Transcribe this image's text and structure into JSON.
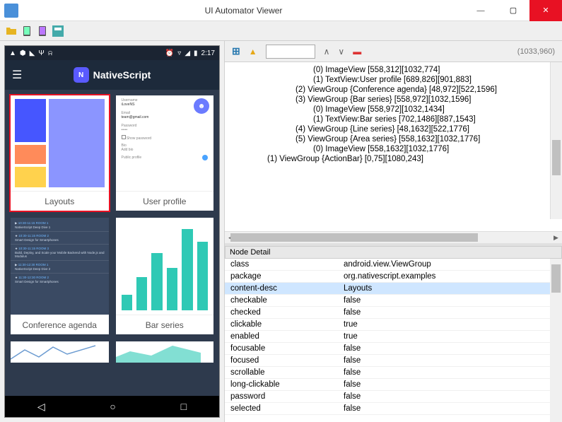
{
  "window": {
    "title": "UI Automator Viewer"
  },
  "phone": {
    "status_time": "2:17",
    "app_name": "NativeScript",
    "app_logo_letter": "N",
    "cards": {
      "layouts": "Layouts",
      "user_profile": "User profile",
      "conference": "Conference agenda",
      "bar_series": "Bar series"
    },
    "profile_fields": {
      "username": "Username",
      "username_val": "iLoveNS",
      "email": "Email",
      "email_val": "team@gmail.com",
      "password": "Password",
      "show_password": "Show password",
      "bio": "Bio",
      "add_bio": "Add bio",
      "public_profile": "Public profile"
    },
    "agenda_items": [
      "NativeScript Deep Dive 1",
      "Smart Design for Smartphones",
      "Build, Deploy, and Scale your Mobile Backend with Node.js and Modulus",
      "NativeScript Deep Dive 2",
      "Smart Design for Smartphones"
    ]
  },
  "tree_toolbar": {
    "coord": "(1033,960)"
  },
  "tree": [
    {
      "indent": 2,
      "text": "(0) ImageView [558,312][1032,774]"
    },
    {
      "indent": 2,
      "text": "(1) TextView:User profile [689,826][901,883]"
    },
    {
      "indent": 1,
      "text": "(2) ViewGroup {Conference agenda} [48,972][522,1596]"
    },
    {
      "indent": 1,
      "text": "(3) ViewGroup {Bar series} [558,972][1032,1596]"
    },
    {
      "indent": 2,
      "text": "(0) ImageView [558,972][1032,1434]"
    },
    {
      "indent": 2,
      "text": "(1) TextView:Bar series [702,1486][887,1543]"
    },
    {
      "indent": 1,
      "text": "(4) ViewGroup {Line series} [48,1632][522,1776]"
    },
    {
      "indent": 1,
      "text": "(5) ViewGroup {Area series} [558,1632][1032,1776]"
    },
    {
      "indent": 2,
      "text": "(0) ImageView [558,1632][1032,1776]"
    },
    {
      "indent": 0,
      "text": "(1) ViewGroup {ActionBar} [0,75][1080,243]"
    }
  ],
  "detail": {
    "header": "Node Detail",
    "rows": [
      {
        "k": "class",
        "v": "android.view.ViewGroup"
      },
      {
        "k": "package",
        "v": "org.nativescript.examples"
      },
      {
        "k": "content-desc",
        "v": "Layouts",
        "sel": true
      },
      {
        "k": "checkable",
        "v": "false"
      },
      {
        "k": "checked",
        "v": "false"
      },
      {
        "k": "clickable",
        "v": "true"
      },
      {
        "k": "enabled",
        "v": "true"
      },
      {
        "k": "focusable",
        "v": "false"
      },
      {
        "k": "focused",
        "v": "false"
      },
      {
        "k": "scrollable",
        "v": "false"
      },
      {
        "k": "long-clickable",
        "v": "false"
      },
      {
        "k": "password",
        "v": "false"
      },
      {
        "k": "selected",
        "v": "false"
      }
    ]
  }
}
